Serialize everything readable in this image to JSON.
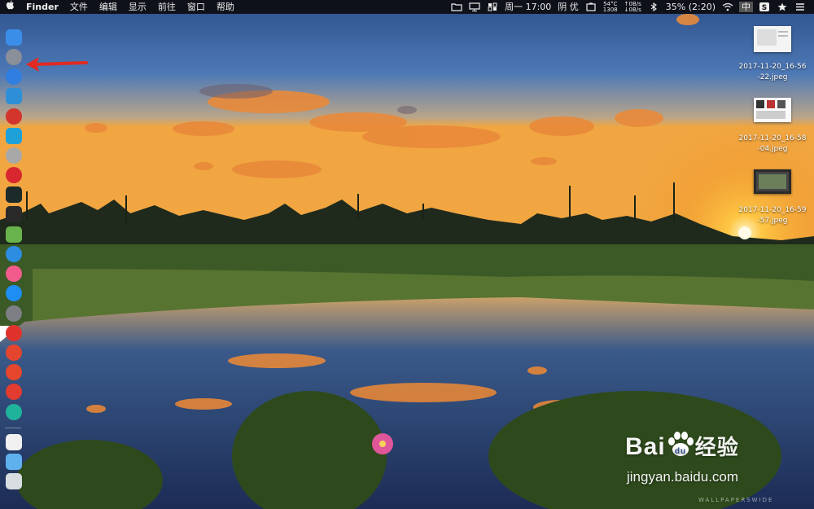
{
  "menubar": {
    "apple": "",
    "app_name": "Finder",
    "menus": [
      "文件",
      "编辑",
      "显示",
      "前往",
      "窗口",
      "帮助"
    ],
    "status": {
      "datetime": "周一 17:00",
      "weather": "阴 优",
      "temp": "54°C",
      "rpm": "1308",
      "net_up": "↑0B/s",
      "net_down": "↓0B/s",
      "battery": "35% (2:20)",
      "input_method": "中"
    }
  },
  "dock": {
    "items": [
      {
        "name": "finder",
        "color": "#3b8ee8"
      },
      {
        "name": "launchpad",
        "color": "#8a8f99"
      },
      {
        "name": "safari",
        "color": "#2f7ee0"
      },
      {
        "name": "preview",
        "color": "#2e8fd6"
      },
      {
        "name": "netease-music",
        "color": "#d3342b"
      },
      {
        "name": "migration",
        "color": "#1fa0d8"
      },
      {
        "name": "disk-utility",
        "color": "#a8a8a8"
      },
      {
        "name": "app-red",
        "color": "#d8272e"
      },
      {
        "name": "activity-monitor",
        "color": "#1c2a2a"
      },
      {
        "name": "terminal",
        "color": "#2a2a2a"
      },
      {
        "name": "maps",
        "color": "#69b34c"
      },
      {
        "name": "app-store-blue",
        "color": "#2d8de0"
      },
      {
        "name": "itunes",
        "color": "#f25b8c"
      },
      {
        "name": "app-store",
        "color": "#1e8ef5"
      },
      {
        "name": "system-preferences",
        "color": "#7d7f84"
      },
      {
        "name": "yandex",
        "color": "#e0322c"
      },
      {
        "name": "chrome",
        "color": "#e4452f"
      },
      {
        "name": "weibo",
        "color": "#e5462c"
      },
      {
        "name": "vivaldi",
        "color": "#e23b2f"
      },
      {
        "name": "app-cyan",
        "color": "#1fb39c"
      },
      {
        "name": "document",
        "color": "#f0f0f0"
      },
      {
        "name": "downloads-folder",
        "color": "#5fb1ee"
      },
      {
        "name": "trash",
        "color": "#d8dde2"
      }
    ]
  },
  "desktop_files": [
    {
      "name": "2017-11-20_16-56\n-22.jpeg"
    },
    {
      "name": "2017-11-20_16-58\n-04.jpeg"
    },
    {
      "name": "2017-11-20_16-59\n-57.jpeg"
    }
  ],
  "watermark": {
    "logo": "Bai",
    "logo_suffix": "经验",
    "url": "jingyan.baidu.com"
  },
  "credit": "WALLPAPERSWIDE"
}
